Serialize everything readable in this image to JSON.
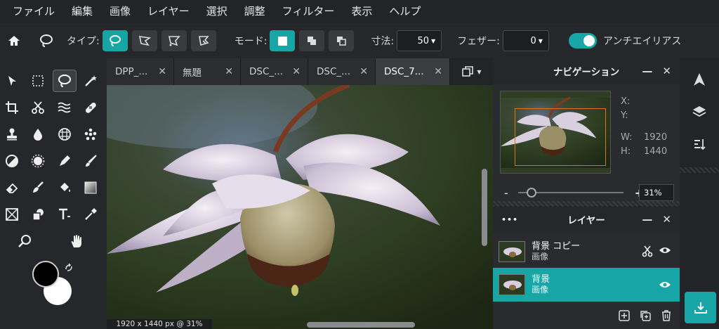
{
  "menu": [
    "ファイル",
    "編集",
    "画像",
    "レイヤー",
    "選択",
    "調整",
    "フィルター",
    "表示",
    "ヘルプ"
  ],
  "toolbar": {
    "type_label": "タイプ:",
    "mode_label": "モード:",
    "size_label": "寸法:",
    "size_value": "50",
    "feather_label": "フェザー:",
    "feather_value": "0",
    "antialias_label": "アンチエイリアス",
    "antialias_on": true
  },
  "tabs": [
    {
      "label": "DPP_...",
      "active": false
    },
    {
      "label": "無題",
      "active": false
    },
    {
      "label": "DSC_...",
      "active": false
    },
    {
      "label": "DSC_...",
      "active": false
    },
    {
      "label": "DSC_7...",
      "active": true
    }
  ],
  "canvas": {
    "status": "1920 x 1440 px @ 31%"
  },
  "navigator": {
    "title": "ナビゲーション",
    "x_label": "X:",
    "y_label": "Y:",
    "w_label": "W:",
    "w_value": "1920",
    "h_label": "H:",
    "h_value": "1440",
    "zoom_value": "31%",
    "minus": "-",
    "plus": "+"
  },
  "layers": {
    "title": "レイヤー",
    "dots": "•••",
    "items": [
      {
        "name": "背景 コピー",
        "type": "画像",
        "active": false
      },
      {
        "name": "背景",
        "type": "画像",
        "active": true
      }
    ]
  },
  "colors": {
    "accent": "#17a5a6",
    "foreground": "#000000",
    "background": "#ffffff"
  }
}
